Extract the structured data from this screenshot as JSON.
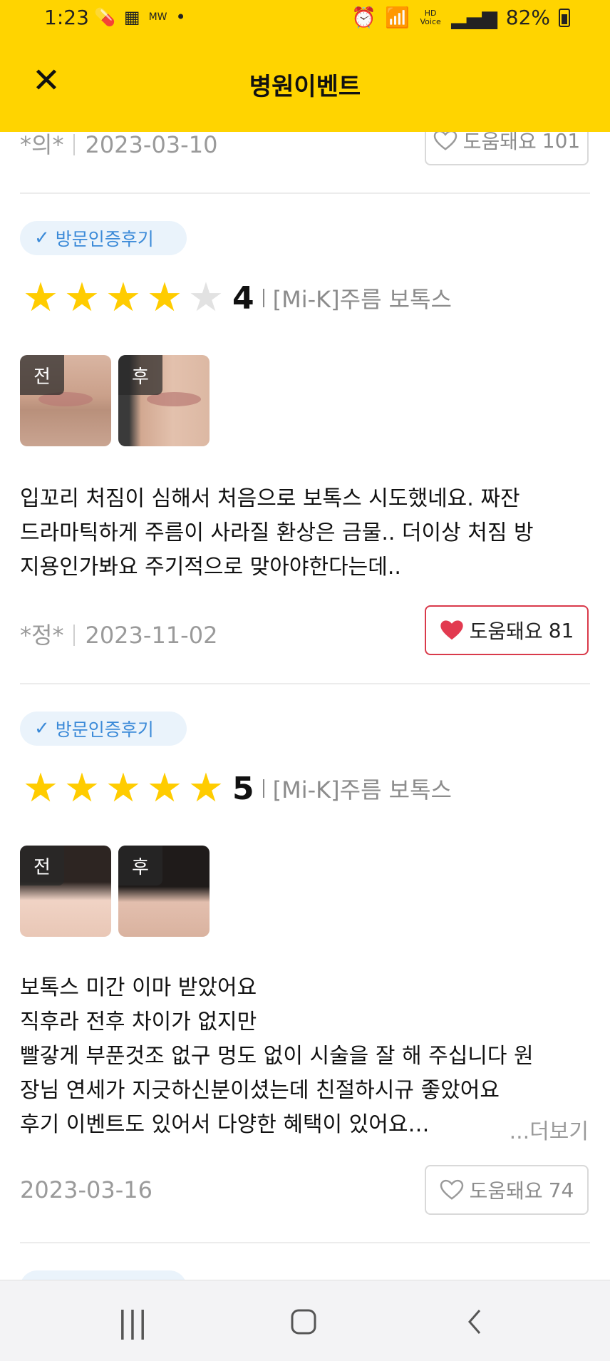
{
  "status_bar": {
    "time": "1:23",
    "left_text": "MW",
    "dot": "•",
    "hd_voice": "HD Voice",
    "battery": "82%"
  },
  "header": {
    "close_icon": "close-icon",
    "title": "병원이벤트"
  },
  "reviews": [
    {
      "author": "*의*",
      "date": "2023-03-10",
      "help_label": "도움돼요",
      "help_count": "101",
      "liked": false
    },
    {
      "badge": "방문인증후기",
      "rating": 4,
      "score_text": "4",
      "product": "[Mi-K]주름 보톡스",
      "before_label": "전",
      "after_label": "후",
      "text_lines": [
        "입꼬리 처짐이 심해서 처음으로 보톡스 시도했네요. 짜잔",
        "드라마틱하게 주름이 사라질 환상은 금물.. 더이상 처짐 방",
        "지용인가봐요 주기적으로 맞아야한다는데.."
      ],
      "author": "*정*",
      "date": "2023-11-02",
      "help_label": "도움돼요",
      "help_count": "81",
      "liked": true
    },
    {
      "badge": "방문인증후기",
      "rating": 5,
      "score_text": "5",
      "product": "[Mi-K]주름 보톡스",
      "before_label": "전",
      "after_label": "후",
      "text_lines": [
        "보톡스 미간 이마 받았어요",
        "직후라 전후 차이가 없지만",
        "빨갛게 부푼것조 없구 멍도 없이 시술을 잘 해 주십니다 원",
        "장님 연세가 지긋하신분이셨는데 친절하시규 좋았어요",
        "후기 이벤트도 있어서 다양한 혜택이 있어요…"
      ],
      "more_label": "...더보기",
      "date": "2023-03-16",
      "help_label": "도움돼요",
      "help_count": "74",
      "liked": false
    }
  ],
  "colors": {
    "brand_yellow": "#ffd400",
    "star": "#ffcc00",
    "badge_blue": "#3b8ad8",
    "heart_red": "#e23a50"
  },
  "nav": {
    "recent_icon": "recent-apps-icon",
    "home_icon": "home-icon",
    "back_icon": "back-icon"
  }
}
